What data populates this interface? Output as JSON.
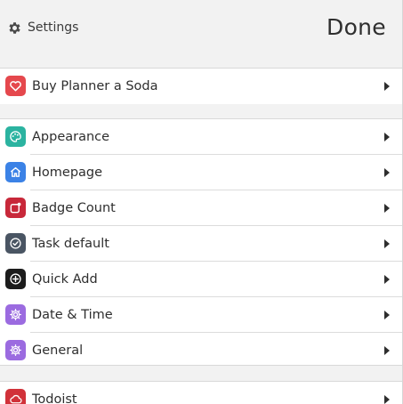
{
  "header": {
    "title": "Settings",
    "title_icon": "gear-icon",
    "done_label": "Done"
  },
  "sections": [
    {
      "items": [
        {
          "label": "Buy Planner a Soda",
          "icon": "heart-icon",
          "color": "#e5484d"
        }
      ]
    },
    {
      "items": [
        {
          "label": "Appearance",
          "icon": "palette-icon",
          "color": "#2bb3a0"
        },
        {
          "label": "Homepage",
          "icon": "home-icon",
          "color": "#3b82e6"
        },
        {
          "label": "Badge Count",
          "icon": "badge-icon",
          "color": "#c8283a"
        },
        {
          "label": "Task default",
          "icon": "check-circle-icon",
          "color": "#4a5563"
        },
        {
          "label": "Quick Add",
          "icon": "plus-circle-icon",
          "color": "#1c1c1c"
        },
        {
          "label": "Date & Time",
          "icon": "cog-icon",
          "color": "#9b6be0"
        },
        {
          "label": "General",
          "icon": "cog-icon",
          "color": "#9b6be0"
        }
      ]
    },
    {
      "items": [
        {
          "label": "Todoist",
          "icon": "cloud-icon",
          "color": "#d1323a"
        }
      ]
    }
  ]
}
